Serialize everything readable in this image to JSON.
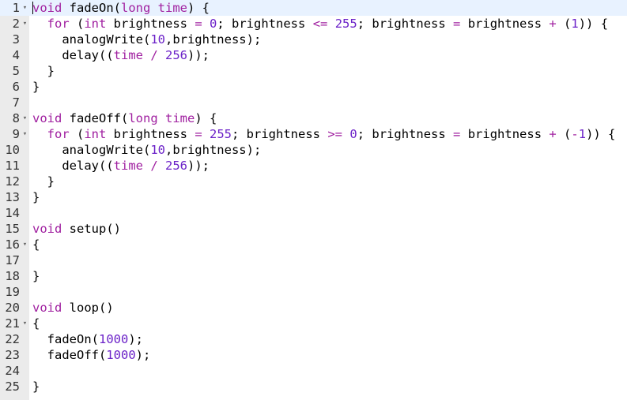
{
  "editor": {
    "fold_glyph": "▾",
    "lines": [
      {
        "n": "1",
        "fold": true,
        "tokens": [
          [
            "kw",
            "void"
          ],
          [
            "txt",
            " fadeOn("
          ],
          [
            "kw",
            "long"
          ],
          [
            "txt",
            " "
          ],
          [
            "kw",
            "time"
          ],
          [
            "txt",
            ") {"
          ]
        ]
      },
      {
        "n": "2",
        "fold": true,
        "tokens": [
          [
            "txt",
            "  "
          ],
          [
            "kw",
            "for"
          ],
          [
            "txt",
            " ("
          ],
          [
            "kw",
            "int"
          ],
          [
            "txt",
            " brightness "
          ],
          [
            "op",
            "="
          ],
          [
            "txt",
            " "
          ],
          [
            "num",
            "0"
          ],
          [
            "txt",
            "; brightness "
          ],
          [
            "op",
            "<="
          ],
          [
            "txt",
            " "
          ],
          [
            "num",
            "255"
          ],
          [
            "txt",
            "; brightness "
          ],
          [
            "op",
            "="
          ],
          [
            "txt",
            " brightness "
          ],
          [
            "op",
            "+"
          ],
          [
            "txt",
            " ("
          ],
          [
            "num",
            "1"
          ],
          [
            "txt",
            ")) {"
          ]
        ]
      },
      {
        "n": "3",
        "fold": false,
        "tokens": [
          [
            "txt",
            "    analogWrite("
          ],
          [
            "num",
            "10"
          ],
          [
            "txt",
            ",brightness);"
          ]
        ]
      },
      {
        "n": "4",
        "fold": false,
        "tokens": [
          [
            "txt",
            "    delay(("
          ],
          [
            "kw",
            "time"
          ],
          [
            "txt",
            " "
          ],
          [
            "op",
            "/"
          ],
          [
            "txt",
            " "
          ],
          [
            "num",
            "256"
          ],
          [
            "txt",
            "));"
          ]
        ]
      },
      {
        "n": "5",
        "fold": false,
        "tokens": [
          [
            "txt",
            "  }"
          ]
        ]
      },
      {
        "n": "6",
        "fold": false,
        "tokens": [
          [
            "txt",
            "}"
          ]
        ]
      },
      {
        "n": "7",
        "fold": false,
        "tokens": []
      },
      {
        "n": "8",
        "fold": true,
        "tokens": [
          [
            "kw",
            "void"
          ],
          [
            "txt",
            " fadeOff("
          ],
          [
            "kw",
            "long"
          ],
          [
            "txt",
            " "
          ],
          [
            "kw",
            "time"
          ],
          [
            "txt",
            ") {"
          ]
        ]
      },
      {
        "n": "9",
        "fold": true,
        "tokens": [
          [
            "txt",
            "  "
          ],
          [
            "kw",
            "for"
          ],
          [
            "txt",
            " ("
          ],
          [
            "kw",
            "int"
          ],
          [
            "txt",
            " brightness "
          ],
          [
            "op",
            "="
          ],
          [
            "txt",
            " "
          ],
          [
            "num",
            "255"
          ],
          [
            "txt",
            "; brightness "
          ],
          [
            "op",
            ">="
          ],
          [
            "txt",
            " "
          ],
          [
            "num",
            "0"
          ],
          [
            "txt",
            "; brightness "
          ],
          [
            "op",
            "="
          ],
          [
            "txt",
            " brightness "
          ],
          [
            "op",
            "+"
          ],
          [
            "txt",
            " ("
          ],
          [
            "op",
            "-"
          ],
          [
            "num",
            "1"
          ],
          [
            "txt",
            ")) {"
          ]
        ]
      },
      {
        "n": "10",
        "fold": false,
        "tokens": [
          [
            "txt",
            "    analogWrite("
          ],
          [
            "num",
            "10"
          ],
          [
            "txt",
            ",brightness);"
          ]
        ]
      },
      {
        "n": "11",
        "fold": false,
        "tokens": [
          [
            "txt",
            "    delay(("
          ],
          [
            "kw",
            "time"
          ],
          [
            "txt",
            " "
          ],
          [
            "op",
            "/"
          ],
          [
            "txt",
            " "
          ],
          [
            "num",
            "256"
          ],
          [
            "txt",
            "));"
          ]
        ]
      },
      {
        "n": "12",
        "fold": false,
        "tokens": [
          [
            "txt",
            "  }"
          ]
        ]
      },
      {
        "n": "13",
        "fold": false,
        "tokens": [
          [
            "txt",
            "}"
          ]
        ]
      },
      {
        "n": "14",
        "fold": false,
        "tokens": []
      },
      {
        "n": "15",
        "fold": false,
        "tokens": [
          [
            "kw",
            "void"
          ],
          [
            "txt",
            " setup()"
          ]
        ]
      },
      {
        "n": "16",
        "fold": true,
        "tokens": [
          [
            "txt",
            "{"
          ]
        ]
      },
      {
        "n": "17",
        "fold": false,
        "tokens": []
      },
      {
        "n": "18",
        "fold": false,
        "tokens": [
          [
            "txt",
            "}"
          ]
        ]
      },
      {
        "n": "19",
        "fold": false,
        "tokens": []
      },
      {
        "n": "20",
        "fold": false,
        "tokens": [
          [
            "kw",
            "void"
          ],
          [
            "txt",
            " loop()"
          ]
        ]
      },
      {
        "n": "21",
        "fold": true,
        "tokens": [
          [
            "txt",
            "{"
          ]
        ]
      },
      {
        "n": "22",
        "fold": false,
        "tokens": [
          [
            "txt",
            "  fadeOn("
          ],
          [
            "num",
            "1000"
          ],
          [
            "txt",
            ");"
          ]
        ]
      },
      {
        "n": "23",
        "fold": false,
        "tokens": [
          [
            "txt",
            "  fadeOff("
          ],
          [
            "num",
            "1000"
          ],
          [
            "txt",
            ");"
          ]
        ]
      },
      {
        "n": "24",
        "fold": false,
        "tokens": []
      },
      {
        "n": "25",
        "fold": false,
        "tokens": [
          [
            "txt",
            "}"
          ]
        ]
      }
    ]
  },
  "colors": {
    "keyword": "#a020a0",
    "number": "#6b21c8",
    "operator": "#a020a0",
    "text": "#000000",
    "gutter_bg": "#ebebeb",
    "active_line_bg": "#e8f2ff"
  }
}
